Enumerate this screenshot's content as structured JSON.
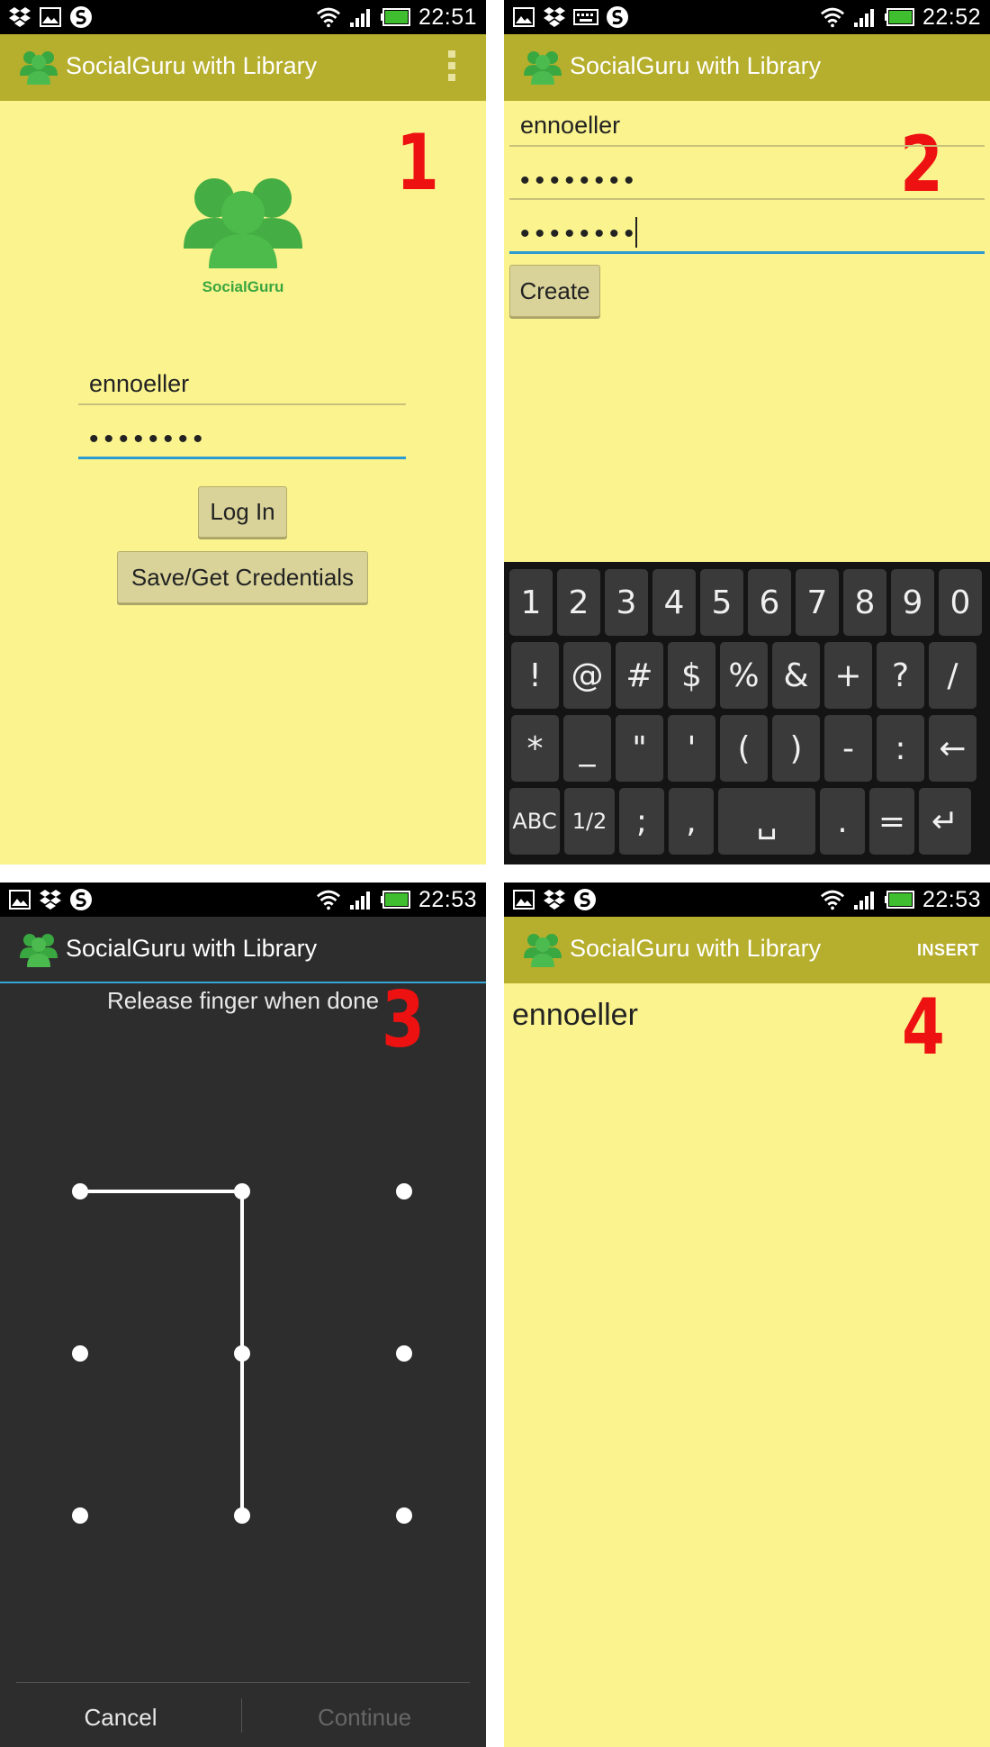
{
  "app": {
    "title": "SocialGuru with Library",
    "accent_bar": "#b6ae2d",
    "background": "#faf38e",
    "step_number_color": "#ee1111",
    "focus_underline": "#2d9bd0"
  },
  "status_icons": [
    "dropbox-icon",
    "image-icon",
    "keyboard-icon",
    "s-circle-icon",
    "wifi-icon",
    "signal-icon",
    "battery-icon"
  ],
  "panel1": {
    "time": "22:51",
    "step": "1",
    "logo_text": "SocialGuru",
    "username": "ennoeller",
    "password_mask": "••••••••",
    "login_label": "Log In",
    "save_label": "Save/Get Credentials"
  },
  "panel2": {
    "time": "22:52",
    "step": "2",
    "username": "ennoeller",
    "password_mask": "••••••••",
    "confirm_mask": "••••••••",
    "create_label": "Create",
    "keyboard": {
      "row1": [
        "1",
        "2",
        "3",
        "4",
        "5",
        "6",
        "7",
        "8",
        "9",
        "0"
      ],
      "row2": [
        "!",
        "@",
        "#",
        "$",
        "%",
        "&",
        "+",
        "?",
        "/"
      ],
      "row3": [
        "*",
        "_",
        "\"",
        "'",
        "(",
        ")",
        "-",
        ":",
        "←"
      ],
      "row4": [
        "ABC",
        "1/2",
        ";",
        ",",
        "␣",
        ".",
        "=",
        "↵"
      ]
    }
  },
  "panel3": {
    "time": "22:53",
    "step": "3",
    "instruction": "Release finger when done",
    "cancel_label": "Cancel",
    "continue_label": "Continue"
  },
  "panel4": {
    "time": "22:53",
    "step": "4",
    "insert_label": "INSERT",
    "item": "ennoeller"
  }
}
